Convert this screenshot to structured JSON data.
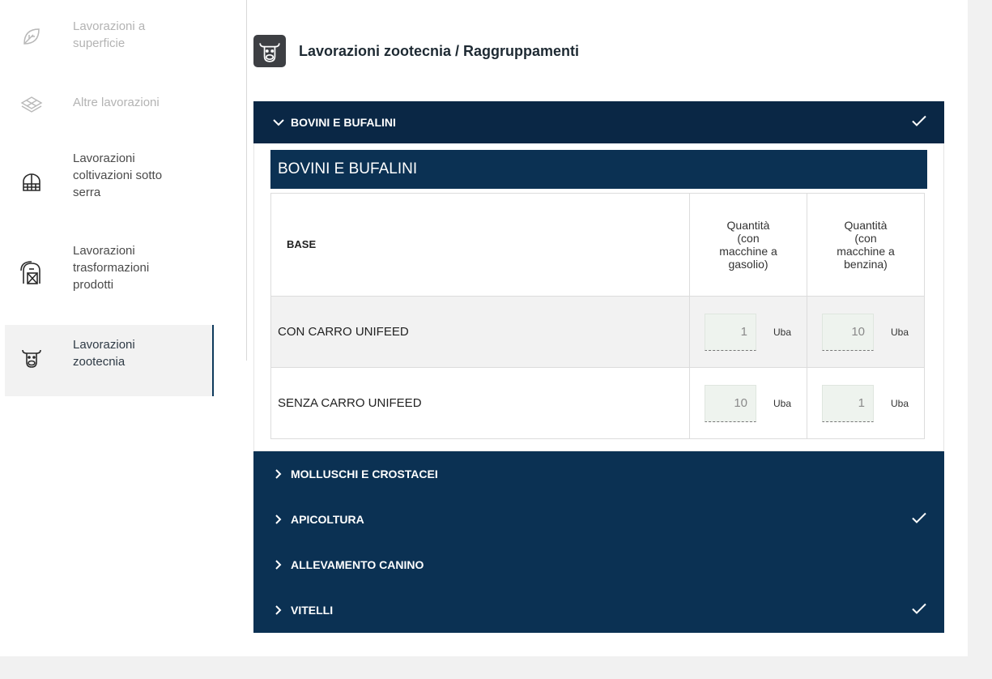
{
  "sidebar": {
    "items": [
      {
        "label_lines": [
          "Lavorazioni a",
          "superficie"
        ],
        "icon": "leaf-icon",
        "state": "disabled"
      },
      {
        "label_lines": [
          "Altre lavorazioni"
        ],
        "icon": "layers-icon",
        "state": "disabled"
      },
      {
        "label_lines": [
          "Lavorazioni",
          "coltivazioni sotto",
          "serra"
        ],
        "icon": "greenhouse-icon",
        "state": "normal"
      },
      {
        "label_lines": [
          "Lavorazioni",
          "trasformazioni",
          "prodotti"
        ],
        "icon": "barn-icon",
        "state": "normal"
      },
      {
        "label_lines": [
          "Lavorazioni",
          "zootecnia"
        ],
        "icon": "cow-icon",
        "state": "active"
      }
    ]
  },
  "main": {
    "title": "Lavorazioni zootecnia / Raggruppamenti",
    "title_icon": "cow-icon"
  },
  "accordion": {
    "open_section": {
      "label": "BOVINI E BUFALINI",
      "completed": true,
      "group_title": "BOVINI E BUFALINI",
      "table": {
        "header_base": "BASE",
        "header_q1": [
          "Quantità",
          "(con",
          "macchine a",
          "gasolio)"
        ],
        "header_q2": [
          "Quantità",
          "(con",
          "macchine a",
          "benzina)"
        ],
        "rows": [
          {
            "name": "CON CARRO UNIFEED",
            "q1": "1",
            "q1_unit": "Uba",
            "q2": "10",
            "q2_unit": "Uba"
          },
          {
            "name": "SENZA CARRO UNIFEED",
            "q1": "10",
            "q1_unit": "Uba",
            "q2": "1",
            "q2_unit": "Uba"
          }
        ]
      }
    },
    "sections": [
      {
        "label": "MOLLUSCHI E CROSTACEI",
        "completed": false
      },
      {
        "label": "APICOLTURA",
        "completed": true
      },
      {
        "label": "ALLEVAMENTO CANINO",
        "completed": false
      },
      {
        "label": "VITELLI",
        "completed": true
      }
    ]
  },
  "colors": {
    "accent": "#0b3153",
    "header_dark": "#0a2745",
    "input_bg": "#eef3ee"
  }
}
